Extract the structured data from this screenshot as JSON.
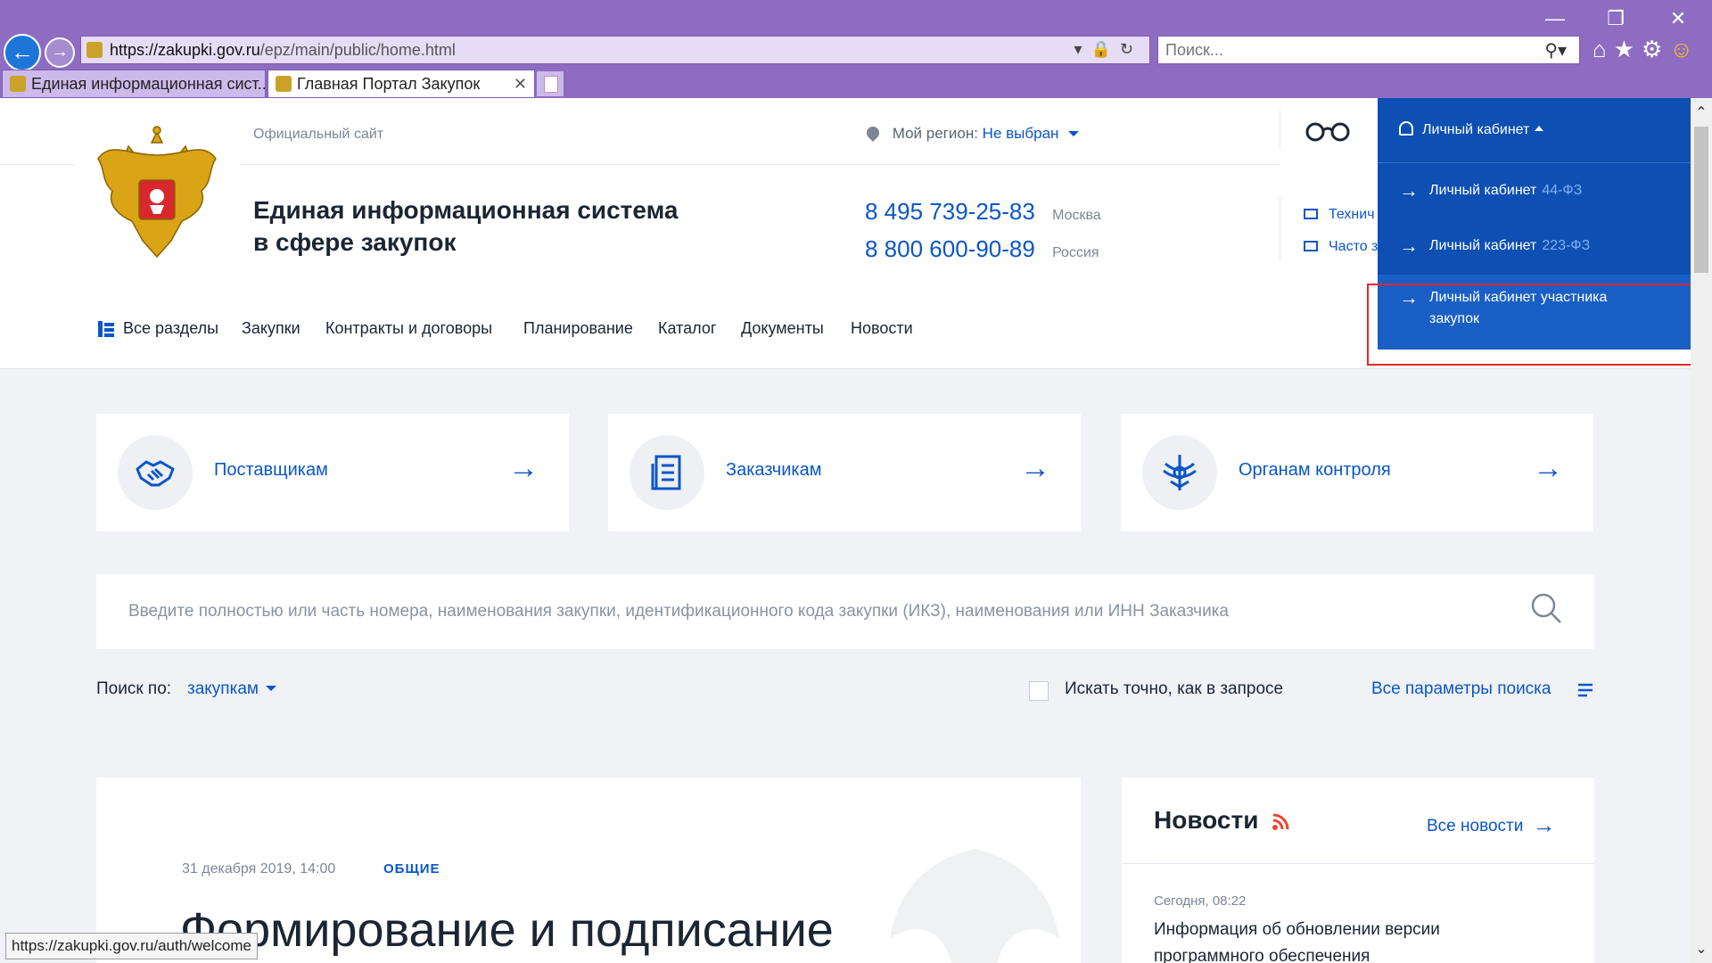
{
  "browser": {
    "url_host": "https://zakupki.gov.ru",
    "url_path": "/epz/main/public/home.html",
    "search_placeholder": "Поиск...",
    "tabs": [
      {
        "title": "Единая информационная сист..."
      },
      {
        "title": "Главная Портал Закупок"
      }
    ],
    "status_url": "https://zakupki.gov.ru/auth/welcome"
  },
  "header": {
    "official": "Официальный сайт",
    "title_line1": "Единая информационная система",
    "title_line2": "в сфере закупок",
    "region_label": "Мой регион:",
    "region_value": "Не выбран",
    "phones": [
      {
        "number": "8 495 739-25-83",
        "city": "Москва"
      },
      {
        "number": "8 800 600-90-89",
        "city": "Россия"
      }
    ],
    "side_links": [
      "Технич",
      "Часто з"
    ]
  },
  "menu": {
    "items": [
      "Все разделы",
      "Закупки",
      "Контракты и договоры",
      "Планирование",
      "Каталог",
      "Документы",
      "Новости"
    ]
  },
  "cabinet": {
    "title": "Личный кабинет",
    "items": [
      {
        "label": "Личный кабинет",
        "law": "44-ФЗ"
      },
      {
        "label": "Личный кабинет",
        "law": "223-ФЗ"
      },
      {
        "label": "Личный кабинет участника закупок"
      }
    ]
  },
  "cards": [
    {
      "label": "Поставщикам"
    },
    {
      "label": "Заказчикам"
    },
    {
      "label": "Органам контроля"
    }
  ],
  "search": {
    "placeholder": "Введите полностью или часть номера, наименования закупки, идентификационного кода закупки (ИКЗ), наименования или ИНН Заказчика",
    "by_label": "Поиск по:",
    "by_value": "закупкам",
    "exact_label": "Искать точно, как в запросе",
    "all_params": "Все параметры поиска"
  },
  "main_news": {
    "date": "31 декабря 2019, 14:00",
    "category": "ОБЩИЕ",
    "headline": "Формирование и подписание"
  },
  "news": {
    "title": "Новости",
    "all": "Все новости",
    "item_date": "Сегодня, 08:22",
    "item_text": "Информация об обновлении версии программного обеспечения"
  },
  "colors": {
    "accent": "#0a56c8",
    "dropdown_bg": "#0d4fb3",
    "browser_frame": "#8e6cc2",
    "highlight_border": "#e0272d"
  }
}
